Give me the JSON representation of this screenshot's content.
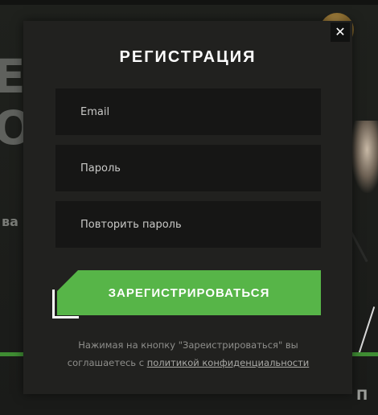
{
  "background": {
    "big_letter_1": "E",
    "big_letter_2": "O",
    "text_left": "ва",
    "text_right": "П"
  },
  "modal": {
    "close_label": "✕",
    "title": "РЕГИСТРАЦИЯ",
    "fields": {
      "email_placeholder": "Email",
      "password_placeholder": "Пароль",
      "repeat_password_placeholder": "Повторить пароль"
    },
    "submit_label": "ЗАРЕГИСТРИРОВАТЬСЯ",
    "notice_line1": "Нажимая на кнопку \"Зареистрироваться\" вы",
    "notice_line2_prefix": "соглашаетесь с ",
    "privacy_link": "политикой конфиденциальности"
  },
  "colors": {
    "accent": "#57b548",
    "modal_bg": "#21211f",
    "field_bg": "#161615"
  }
}
